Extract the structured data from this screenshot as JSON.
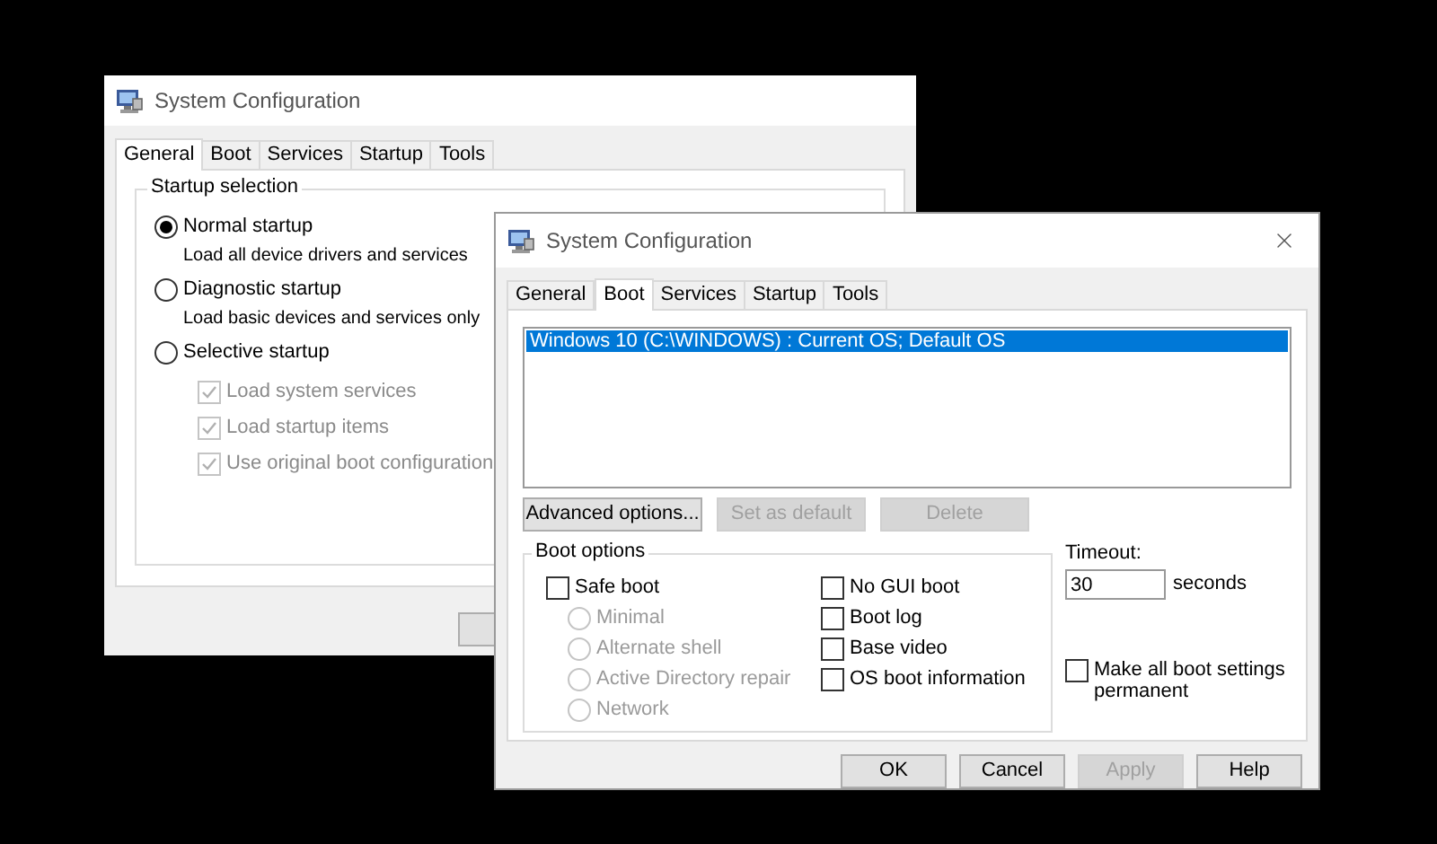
{
  "back_window": {
    "title": "System Configuration",
    "tabs": [
      {
        "label": "General",
        "selected": true
      },
      {
        "label": "Boot",
        "selected": false
      },
      {
        "label": "Services",
        "selected": false
      },
      {
        "label": "Startup",
        "selected": false
      },
      {
        "label": "Tools",
        "selected": false
      }
    ],
    "startup_selection": {
      "label": "Startup selection",
      "options": [
        {
          "label": "Normal startup",
          "description": "Load all device drivers and services",
          "selected": true
        },
        {
          "label": "Diagnostic startup",
          "description": "Load basic devices and services only",
          "selected": false
        },
        {
          "label": "Selective startup",
          "selected": false
        }
      ],
      "selective_items": [
        {
          "label": "Load system services",
          "checked": true,
          "disabled": true
        },
        {
          "label": "Load startup items",
          "checked": true,
          "disabled": true
        },
        {
          "label": "Use original boot configuration",
          "checked": true,
          "disabled": true
        }
      ]
    }
  },
  "front_window": {
    "title": "System Configuration",
    "tabs": [
      {
        "label": "General",
        "selected": false
      },
      {
        "label": "Boot",
        "selected": true
      },
      {
        "label": "Services",
        "selected": false
      },
      {
        "label": "Startup",
        "selected": false
      },
      {
        "label": "Tools",
        "selected": false
      }
    ],
    "boot_entries": [
      {
        "text": "Windows 10 (C:\\WINDOWS) : Current OS; Default OS",
        "selected": true
      }
    ],
    "entry_buttons": [
      {
        "label": "Advanced options...",
        "disabled": false
      },
      {
        "label": "Set as default",
        "disabled": true
      },
      {
        "label": "Delete",
        "disabled": true
      }
    ],
    "boot_options": {
      "label": "Boot options",
      "safe_boot": {
        "label": "Safe boot",
        "checked": false
      },
      "safe_modes": [
        {
          "label": "Minimal",
          "selected": false,
          "disabled": true
        },
        {
          "label": "Alternate shell",
          "selected": false,
          "disabled": true
        },
        {
          "label": "Active Directory repair",
          "selected": false,
          "disabled": true
        },
        {
          "label": "Network",
          "selected": false,
          "disabled": true
        }
      ],
      "flags": [
        {
          "label": "No GUI boot",
          "checked": false
        },
        {
          "label": "Boot log",
          "checked": false
        },
        {
          "label": "Base video",
          "checked": false
        },
        {
          "label": "OS boot information",
          "checked": false
        }
      ]
    },
    "timeout": {
      "label": "Timeout:",
      "value": "30",
      "unit": "seconds"
    },
    "permanent": {
      "label": "Make all boot settings permanent",
      "checked": false
    },
    "footer_buttons": [
      {
        "label": "OK",
        "disabled": false
      },
      {
        "label": "Cancel",
        "disabled": false
      },
      {
        "label": "Apply",
        "disabled": true
      },
      {
        "label": "Help",
        "disabled": false
      }
    ]
  }
}
